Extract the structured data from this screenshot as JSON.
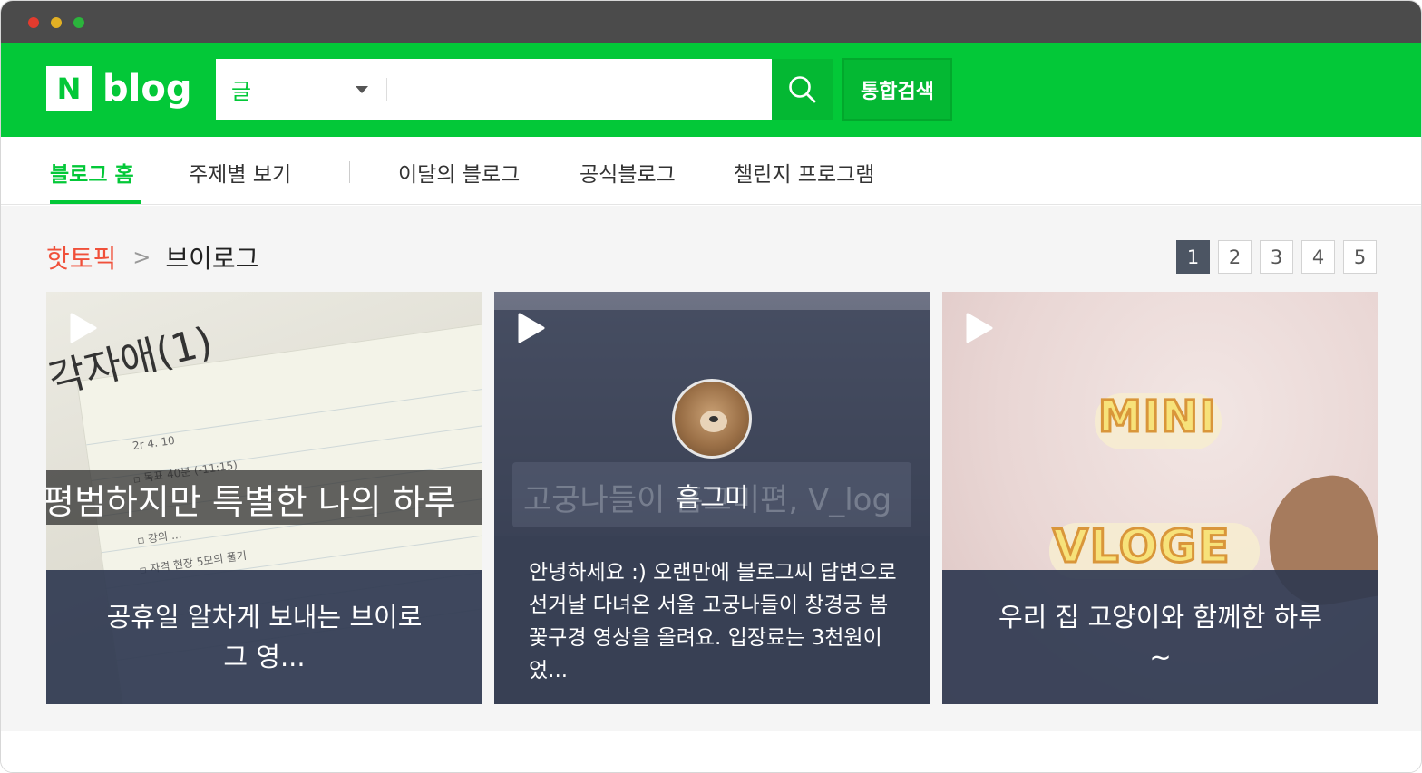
{
  "header": {
    "logo_letter": "N",
    "logo_text": "blog",
    "search_scope": "글",
    "search_value": "",
    "search_button_icon": "search-icon",
    "total_search_label": "통합검색"
  },
  "nav": {
    "items": [
      {
        "label": "블로그 홈",
        "active": true
      },
      {
        "label": "주제별 보기"
      },
      {
        "label": "이달의 블로그"
      },
      {
        "label": "공식블로그"
      },
      {
        "label": "챌린지 프로그램"
      }
    ]
  },
  "section": {
    "hot": "핫토픽",
    "separator": ">",
    "topic": "브이로그"
  },
  "pager": {
    "pages": [
      "1",
      "2",
      "3",
      "4",
      "5"
    ],
    "current": "1"
  },
  "cards": [
    {
      "image_text_top": "각자애(1)",
      "image_text_band": "평범하지만 특별한 나의 하루",
      "title": "공휴일 알차게 보내는 브이로그 영..."
    },
    {
      "ghost_title": "고궁나들이 흠그미편, V_log",
      "author": "흠그미",
      "description": "안녕하세요 :) 오랜만에 블로그씨 답변으로 선거날 다녀온 서울 고궁나들이 창경궁 봄꽃구경 영상을 올려요. 입장료는 3천원이었..."
    },
    {
      "sticker_top": "MINI",
      "sticker_bottom": "VLOGE",
      "title": "우리 집 고양이와 함께한 하루~"
    }
  ],
  "colors": {
    "brand_green": "#03c838",
    "hot_red": "#f0503a",
    "overlay": "#2f3850"
  }
}
